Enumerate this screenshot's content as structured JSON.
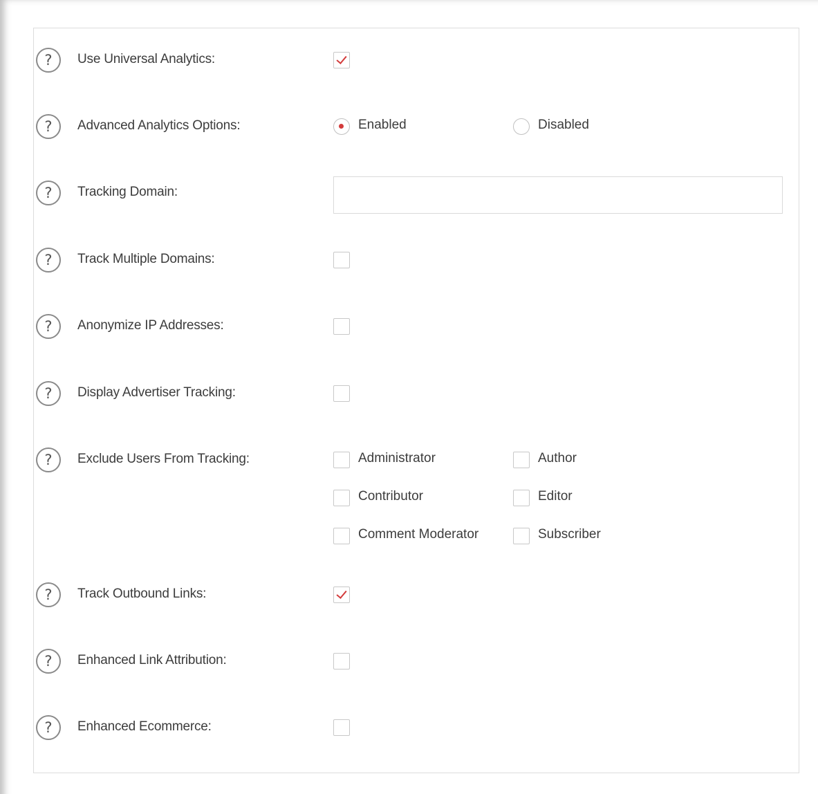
{
  "form": {
    "help_glyph": "?",
    "universal_analytics": {
      "label": "Use Universal Analytics:",
      "checked": true
    },
    "advanced_options": {
      "label": "Advanced Analytics Options:",
      "options": [
        {
          "label": "Enabled",
          "selected": true
        },
        {
          "label": "Disabled",
          "selected": false
        }
      ]
    },
    "tracking_domain": {
      "label": "Tracking Domain:",
      "value": "",
      "placeholder": ""
    },
    "multiple_domains": {
      "label": "Track Multiple Domains:",
      "checked": false
    },
    "anonymize_ip": {
      "label": "Anonymize IP Addresses:",
      "checked": false
    },
    "advertiser_tracking": {
      "label": "Display Advertiser Tracking:",
      "checked": false
    },
    "exclude_users": {
      "label": "Exclude Users From Tracking:",
      "roles": [
        {
          "label": "Administrator",
          "checked": false
        },
        {
          "label": "Author",
          "checked": false
        },
        {
          "label": "Contributor",
          "checked": false
        },
        {
          "label": "Editor",
          "checked": false
        },
        {
          "label": "Comment Moderator",
          "checked": false
        },
        {
          "label": "Subscriber",
          "checked": false
        }
      ]
    },
    "outbound_links": {
      "label": "Track Outbound Links:",
      "checked": true
    },
    "link_attribution": {
      "label": "Enhanced Link Attribution:",
      "checked": false
    },
    "ecommerce": {
      "label": "Enhanced Ecommerce:",
      "checked": false
    }
  },
  "colors": {
    "accent": "#d33b3b",
    "border": "#dcdcdc",
    "text": "#3c3c3c"
  }
}
